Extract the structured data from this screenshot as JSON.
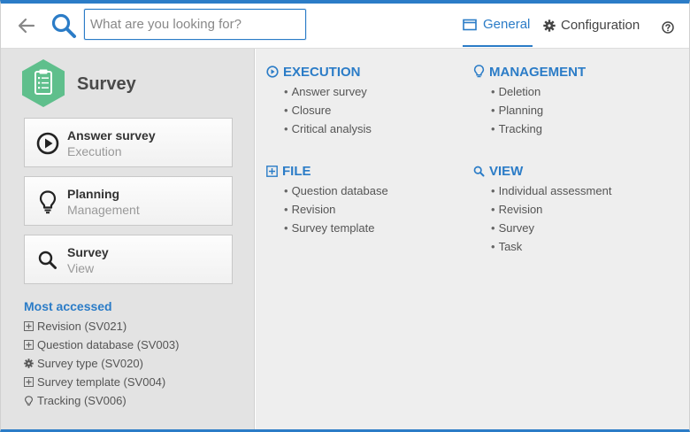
{
  "search": {
    "placeholder": "What are you looking for?",
    "value": ""
  },
  "tabs": {
    "general": "General",
    "configuration": "Configuration"
  },
  "module": {
    "title": "Survey"
  },
  "cards": [
    {
      "title": "Answer survey",
      "subtitle": "Execution",
      "icon": "play-circle-icon"
    },
    {
      "title": "Planning",
      "subtitle": "Management",
      "icon": "lightbulb-icon"
    },
    {
      "title": "Survey",
      "subtitle": "View",
      "icon": "search-icon"
    }
  ],
  "most_accessed": {
    "title": "Most accessed",
    "items": [
      {
        "label": "Revision (SV021)",
        "icon": "plus-box-icon"
      },
      {
        "label": "Question database (SV003)",
        "icon": "plus-box-icon"
      },
      {
        "label": "Survey type (SV020)",
        "icon": "gear-icon"
      },
      {
        "label": "Survey template (SV004)",
        "icon": "plus-box-icon"
      },
      {
        "label": "Tracking (SV006)",
        "icon": "lightbulb-icon"
      }
    ]
  },
  "sections": {
    "execution": {
      "title": "EXECUTION",
      "icon": "play-circle-icon",
      "items": [
        "Answer survey",
        "Closure",
        "Critical analysis"
      ]
    },
    "management": {
      "title": "MANAGEMENT",
      "icon": "lightbulb-icon",
      "items": [
        "Deletion",
        "Planning",
        "Tracking"
      ]
    },
    "file": {
      "title": "FILE",
      "icon": "plus-box-icon",
      "items": [
        "Question database",
        "Revision",
        "Survey template"
      ]
    },
    "view": {
      "title": "VIEW",
      "icon": "search-icon",
      "items": [
        "Individual assessment",
        "Revision",
        "Survey",
        "Task"
      ]
    }
  },
  "colors": {
    "accent": "#2b7cc7",
    "badge": "#5fbf8c",
    "left_panel": "#e3e3e3",
    "right_panel": "#eeeeee"
  }
}
